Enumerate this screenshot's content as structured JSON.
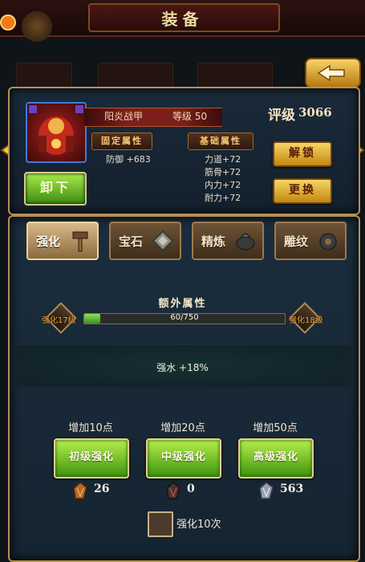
{
  "header": {
    "title": "装备"
  },
  "equipment": {
    "name": "阳炎战甲",
    "level": "等级 50",
    "fixed_attr_title": "固定属性",
    "fixed_attrs": [
      "防御  +683"
    ],
    "base_attr_title": "基础属性",
    "base_attrs": [
      "力道+72",
      "筋骨+72",
      "内力+72",
      "耐力+72"
    ],
    "rating_label": "评级",
    "rating_value": "3066",
    "unequip_label": "卸下",
    "unlock_label": "解锁",
    "replace_label": "更换"
  },
  "tabs": [
    {
      "label": "强化",
      "active": true
    },
    {
      "label": "宝石",
      "active": false
    },
    {
      "label": "精炼",
      "active": false
    },
    {
      "label": "雕纹",
      "active": false
    }
  ],
  "enhance": {
    "extra_title": "额外属性",
    "current_level": "强化17级",
    "next_level": "强化18级",
    "progress_text": "60/750",
    "progress_fraction": 0.08,
    "bonus": "强水  +18%",
    "options": [
      {
        "points": "增加10点",
        "button": "初级强化",
        "cost": "26"
      },
      {
        "points": "增加20点",
        "button": "中级强化",
        "cost": "0"
      },
      {
        "points": "增加50点",
        "button": "高级强化",
        "cost": "563"
      }
    ],
    "repeat_label": "强化10次"
  },
  "colors": {
    "panel_border": "#b49153",
    "green_button": "#6cc425",
    "gold_button": "#e8b23a"
  }
}
